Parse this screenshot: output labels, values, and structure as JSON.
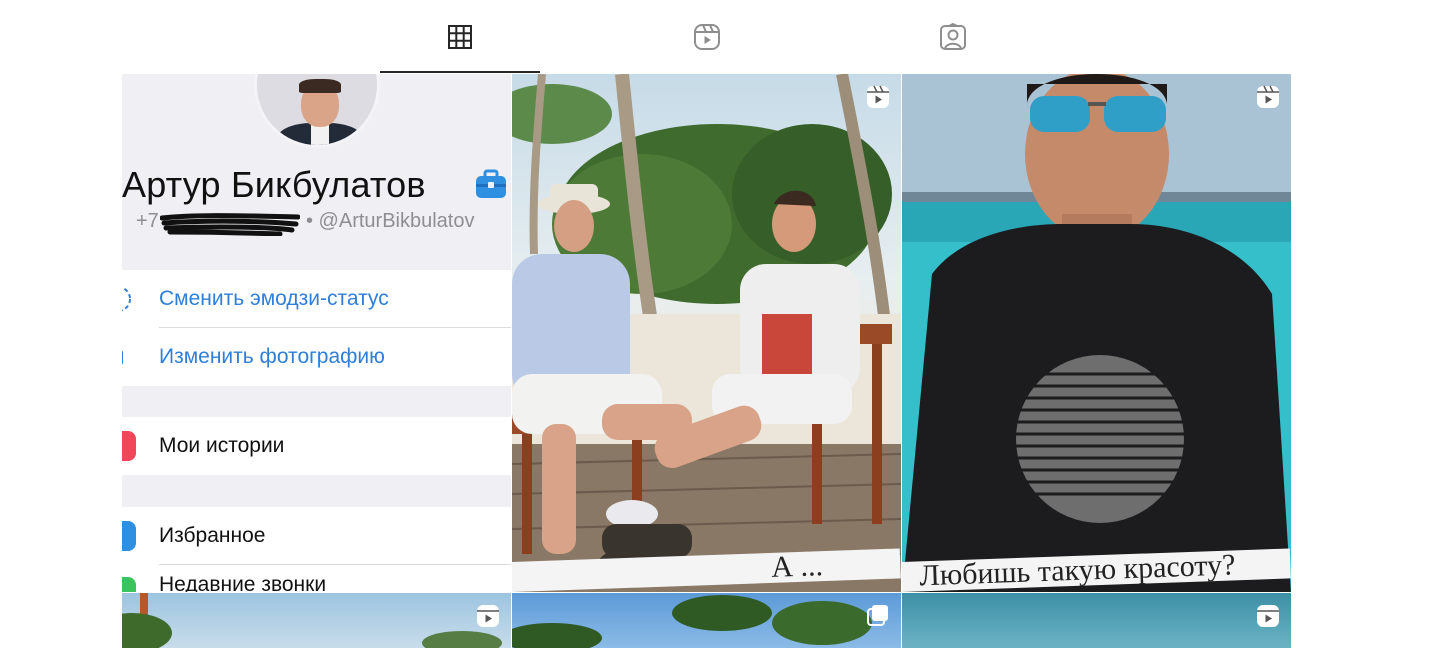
{
  "tabs": [
    {
      "name": "posts",
      "icon": "grid-icon",
      "active": true
    },
    {
      "name": "reels",
      "icon": "reels-icon",
      "active": false
    },
    {
      "name": "tagged",
      "icon": "tagged-icon",
      "active": false
    }
  ],
  "posts": {
    "profile_card": {
      "name": "Артур Бикбулатов",
      "phone_prefix": "+7",
      "handle": "• @ArturBikbulatov",
      "menu_groups": [
        [
          "Сменить эмодзи-статус",
          "Изменить фотографию"
        ],
        [
          "Мои истории"
        ],
        [
          "Избранное",
          "Недавние звонки"
        ]
      ]
    },
    "tile2_caption": "А ...",
    "tile3_caption": "Любишь такую красоту?"
  },
  "colors": {
    "accent_blue": "#2f7fd8",
    "tab_active": "#262626",
    "tab_inactive": "#8e8e8e"
  }
}
